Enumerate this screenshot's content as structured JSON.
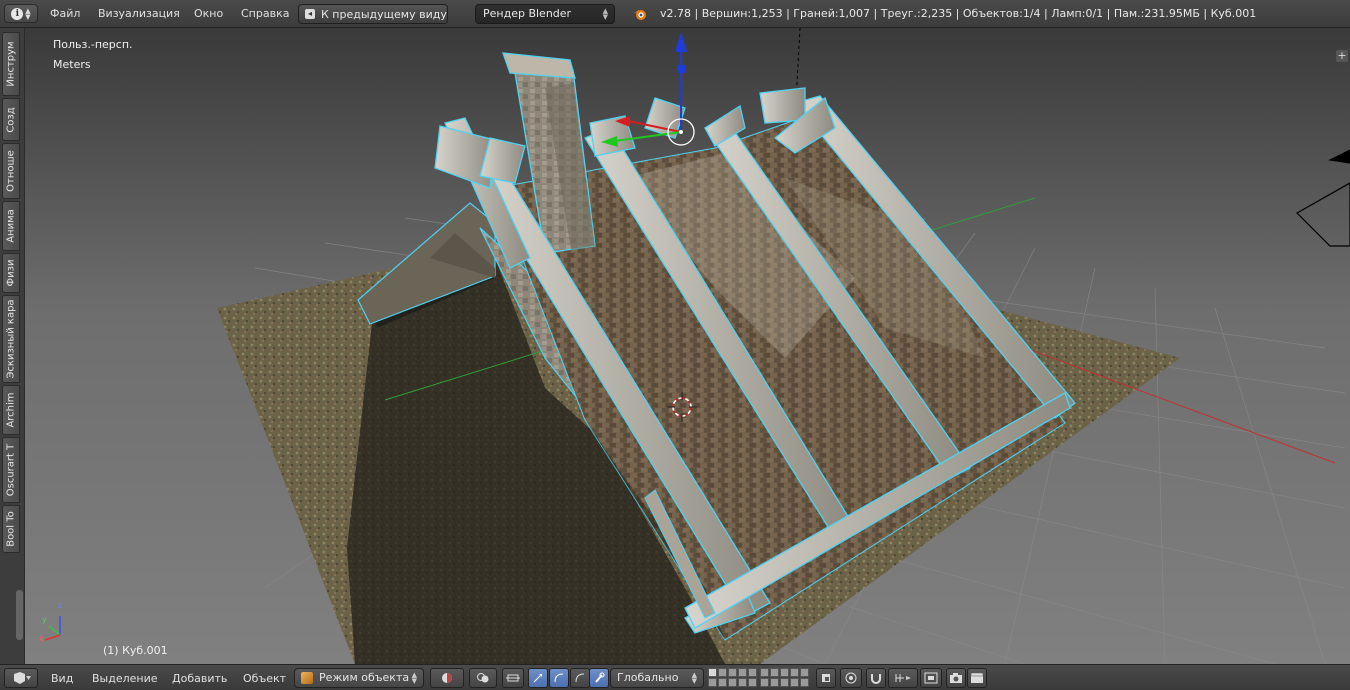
{
  "header": {
    "menus": [
      "Файл",
      "Визуализация",
      "Окно",
      "Справка"
    ],
    "back_button": "К предыдущему виду",
    "render_engine": "Рендер Blender",
    "stats": "v2.78 | Вершин:1,253 | Граней:1,007 | Треуг.:2,235 | Объектов:1/4 | Ламп:0/1 | Пам.:231.95МБ | Куб.001"
  },
  "tool_shelf": {
    "tabs": [
      "Инструм",
      "Созд",
      "Отноше",
      "Анима",
      "Физи",
      "Эскизный кара",
      "Archim",
      "Oscurart T",
      "Bool To"
    ]
  },
  "viewport": {
    "view_label": "Польз.-персп.",
    "units_label": "Meters",
    "object_label": "(1) Куб.001",
    "axis_labels": {
      "x": "x",
      "y": "y",
      "z": "z"
    }
  },
  "footer": {
    "menus": [
      "Вид",
      "Выделение",
      "Добавить",
      "Объект"
    ],
    "mode": "Режим объекта",
    "orientation": "Глобально"
  },
  "colors": {
    "selection_outline": "#4fd2f2",
    "ground_color": "#6a6145",
    "roof_color": "#6b5a45",
    "manipulator_x": "#d21e1e",
    "manipulator_y": "#1ec81e",
    "manipulator_z": "#1e3cdc"
  }
}
